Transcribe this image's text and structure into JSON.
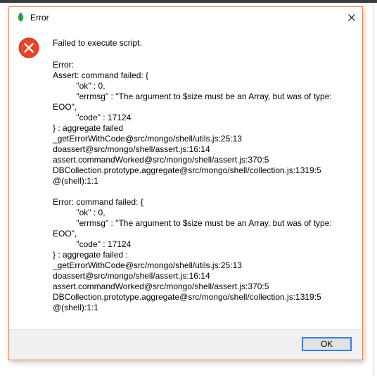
{
  "window": {
    "title": "Error"
  },
  "message": {
    "title": "Failed to execute script.",
    "details": "Error:\nAssert: command failed: {\n\t\"ok\" : 0,\n\t\"errmsg\" : \"The argument to $size must be an Array, but was of type: EOO\",\n\t\"code\" : 17124\n} : aggregate failed\n_getErrorWithCode@src/mongo/shell/utils.js:25:13\ndoassert@src/mongo/shell/assert.js:16:14\nassert.commandWorked@src/mongo/shell/assert.js:370:5\nDBCollection.prototype.aggregate@src/mongo/shell/collection.js:1319:5\n@(shell):1:1\n\nError: command failed: {\n\t\"ok\" : 0,\n\t\"errmsg\" : \"The argument to $size must be an Array, but was of type: EOO\",\n\t\"code\" : 17124\n} : aggregate failed :\n_getErrorWithCode@src/mongo/shell/utils.js:25:13\ndoassert@src/mongo/shell/assert.js:16:14\nassert.commandWorked@src/mongo/shell/assert.js:370:5\nDBCollection.prototype.aggregate@src/mongo/shell/collection.js:1319:5\n@(shell):1:1"
  },
  "footer": {
    "ok_label": "OK"
  },
  "icons": {
    "app": "leaf-icon",
    "error": "error-circle-icon",
    "close": "close-icon"
  },
  "colors": {
    "window_border": "#f0844c",
    "error_icon": "#e8442b",
    "app_icon": "#3aa64a",
    "ok_button_border": "#3c7fd7"
  }
}
